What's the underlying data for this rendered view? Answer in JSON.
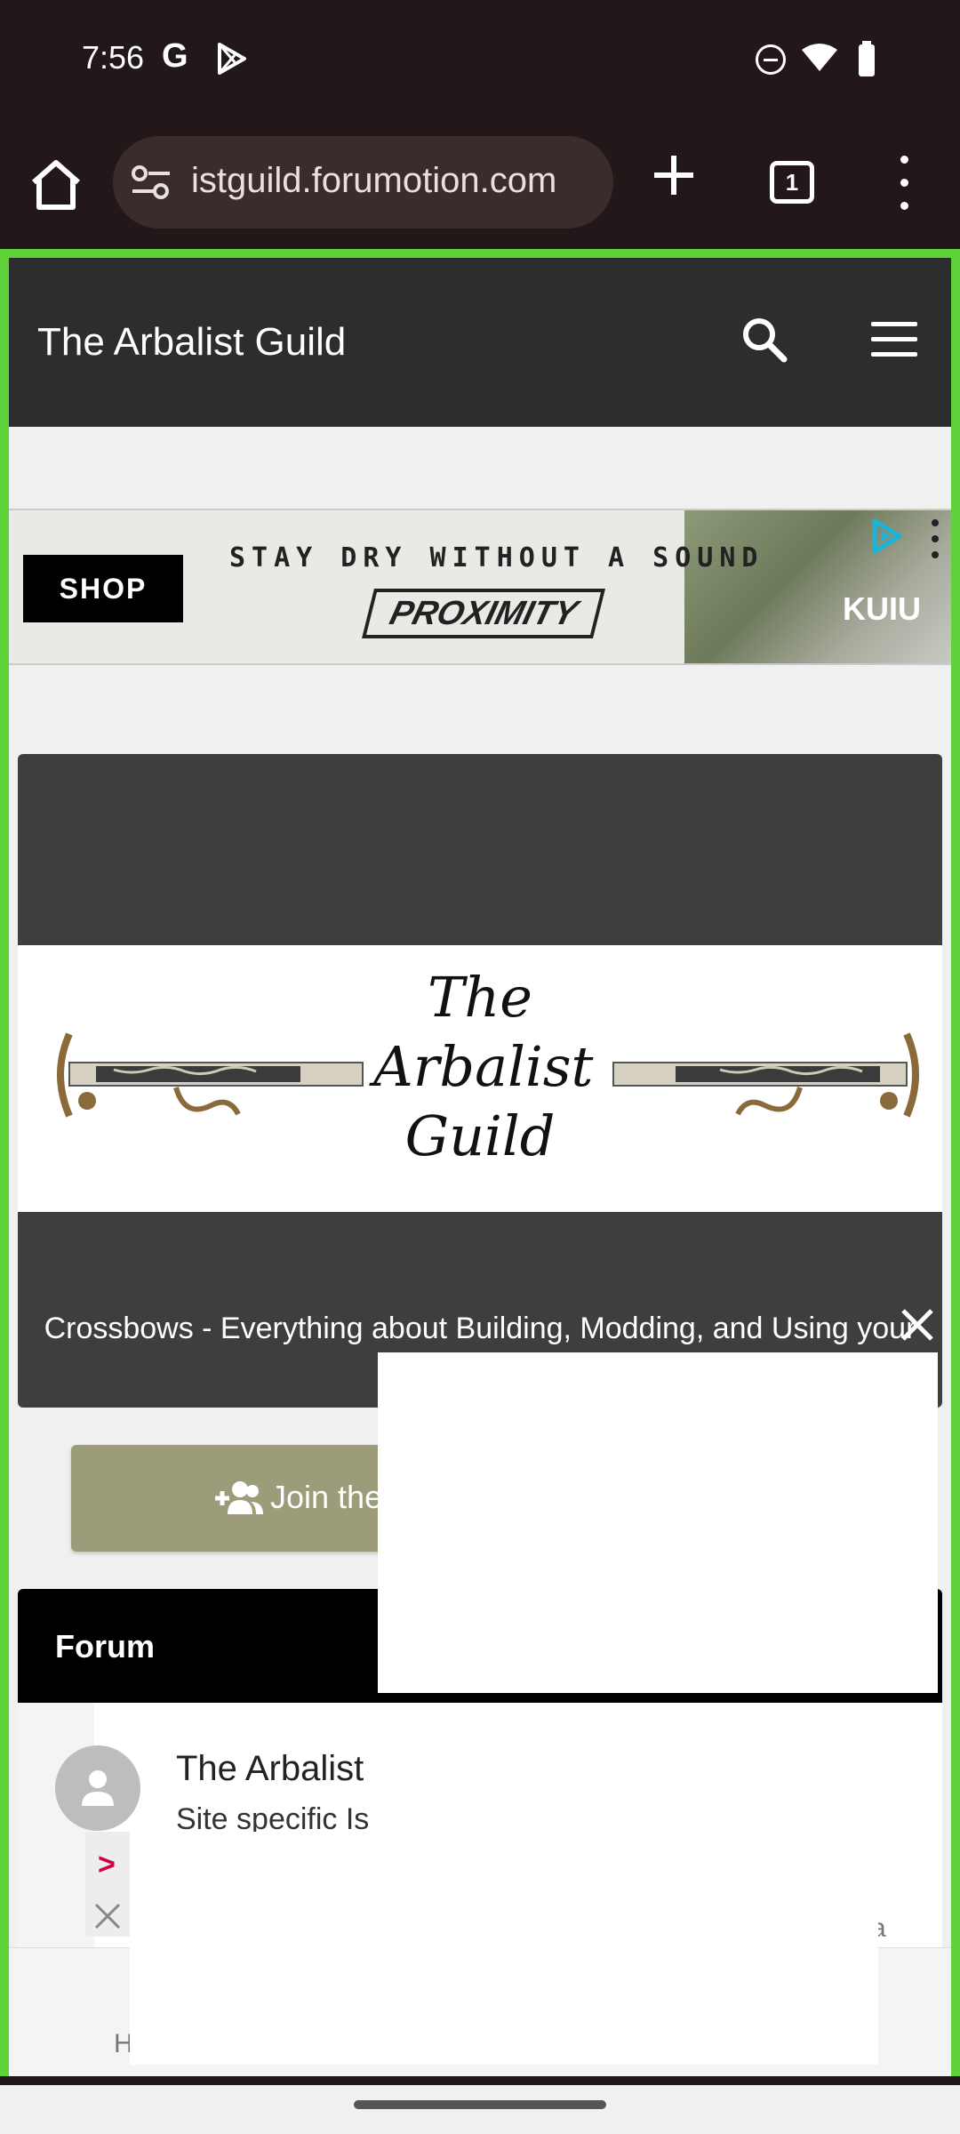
{
  "status_bar": {
    "time": "7:56",
    "g_label": "G"
  },
  "browser": {
    "url": "istguild.forumotion.com",
    "tab_count": "1"
  },
  "site": {
    "title": "The Arbalist Guild"
  },
  "ad": {
    "shop_label": "SHOP",
    "tagline": "STAY DRY WITHOUT A SOUND",
    "brand": "PROXIMITY",
    "maker": "KUIU"
  },
  "banner": {
    "logo_text": "The Arbalist Guild",
    "description": "Crossbows - Everything about Building, Modding, and Using your"
  },
  "join": {
    "label": "Join the"
  },
  "forum": {
    "header": "Forum",
    "rows": [
      {
        "title": "The Arbalist",
        "subtitle": "Site specific Is"
      }
    ]
  },
  "bottom_ad": {
    "arrow": ">",
    "left_text": "H",
    "right_text": "a"
  },
  "colors": {
    "accent_border": "#5ed13b",
    "header_bg": "#2d2d2f",
    "join_button": "#9c9c7b"
  }
}
